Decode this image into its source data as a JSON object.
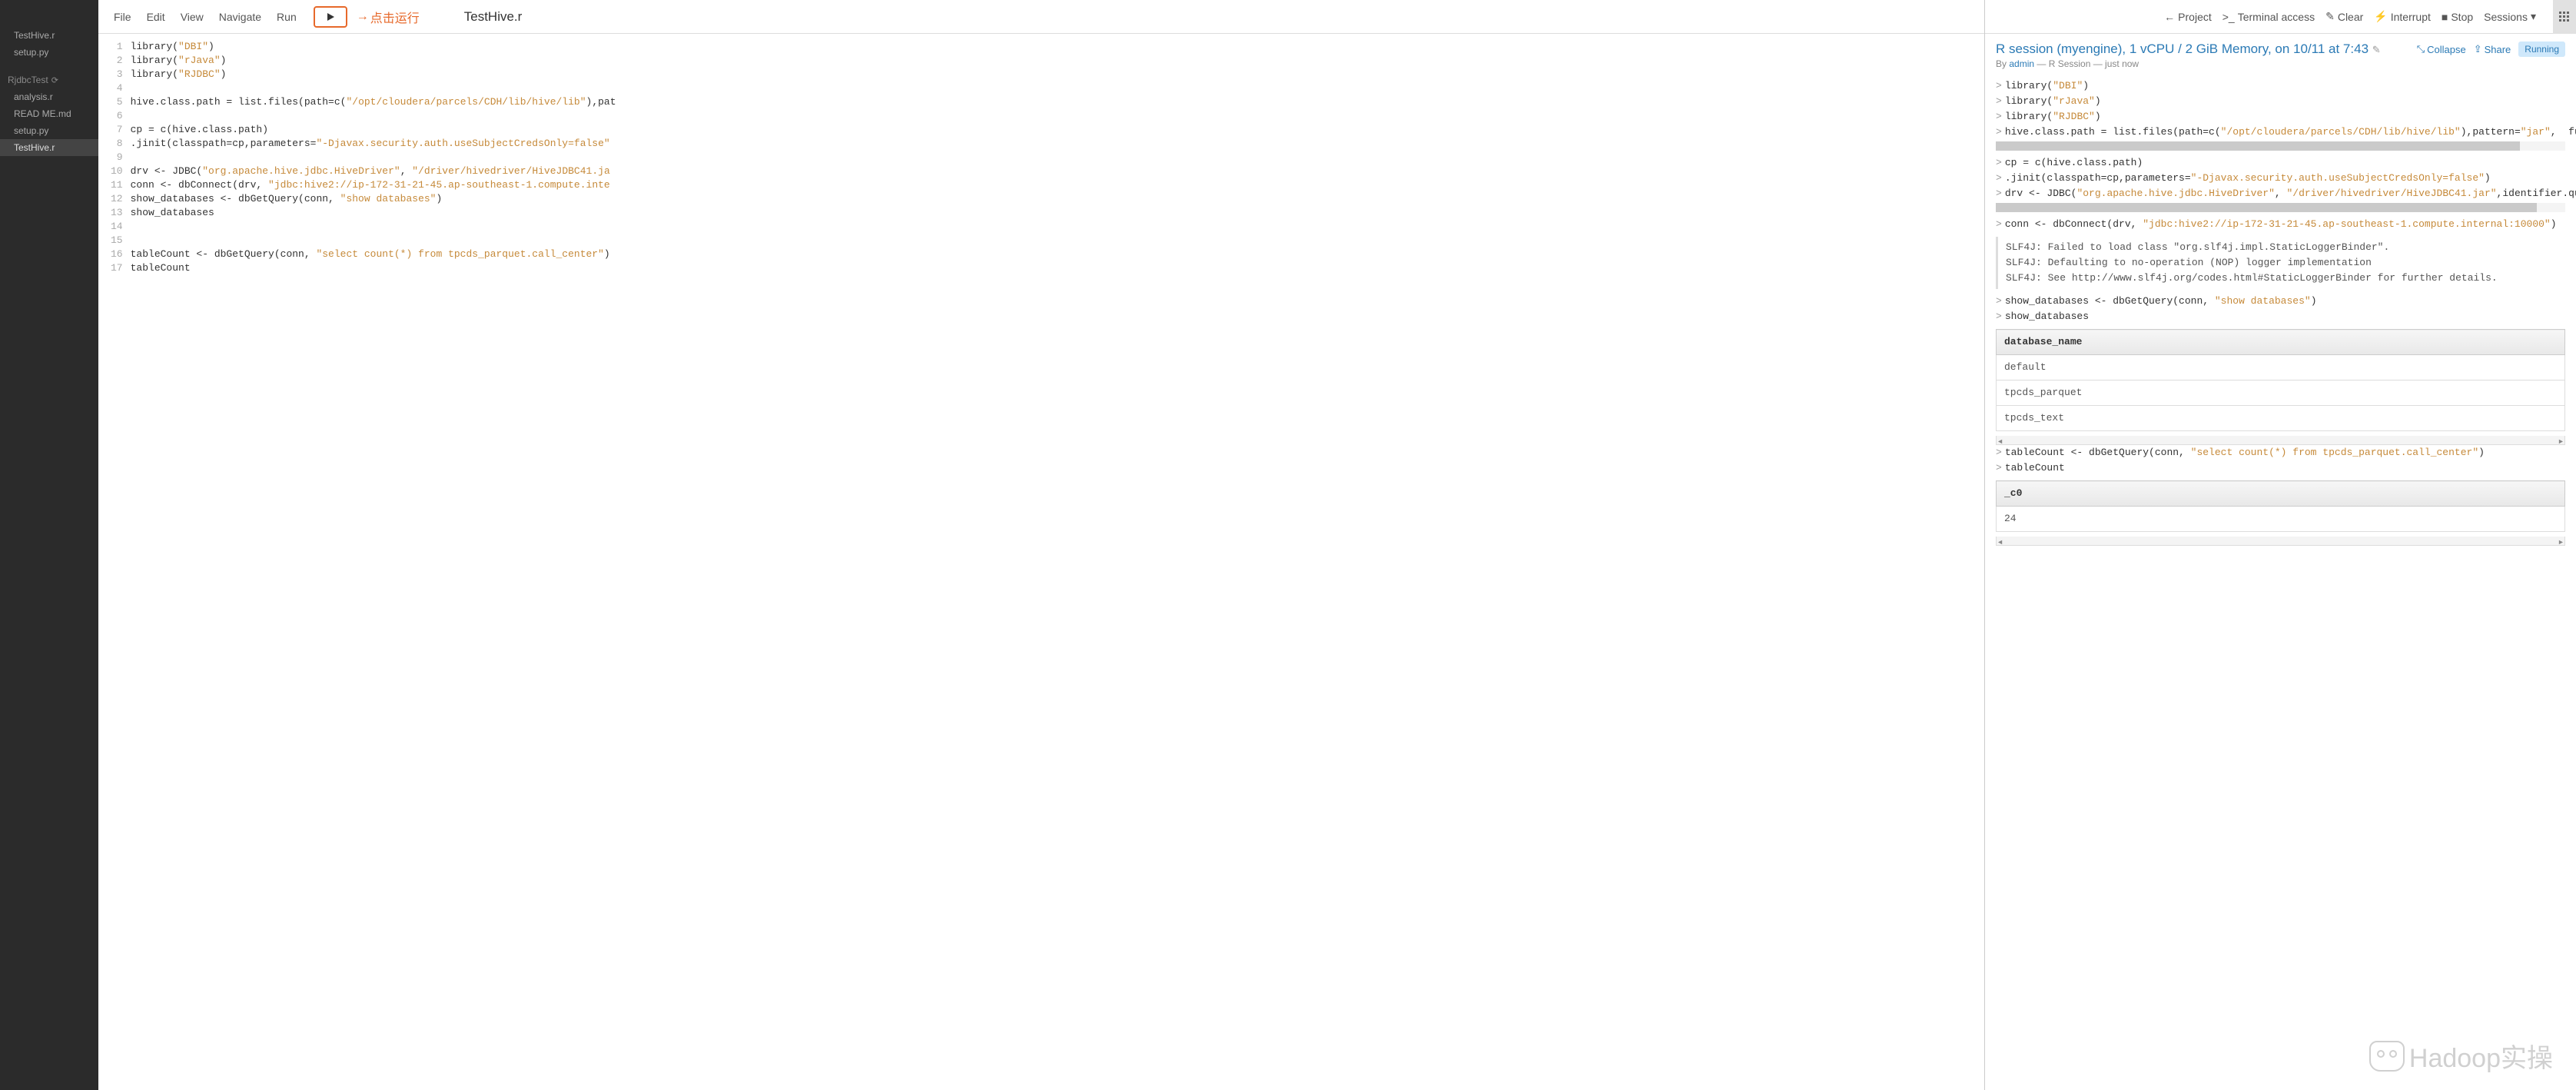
{
  "sidebar": {
    "group1": [
      "TestHive.r",
      "setup.py"
    ],
    "project_header": "RjdbcTest",
    "group2": [
      "analysis.r",
      "READ ME.md",
      "setup.py",
      "TestHive.r"
    ],
    "active": "TestHive.r"
  },
  "menubar": [
    "File",
    "Edit",
    "View",
    "Navigate",
    "Run"
  ],
  "annotation": "点击运行",
  "filename": "TestHive.r",
  "editor": {
    "lines": [
      {
        "n": 1,
        "tokens": [
          {
            "t": "library("
          },
          {
            "t": "\"DBI\"",
            "c": "str"
          },
          {
            "t": ")"
          }
        ]
      },
      {
        "n": 2,
        "tokens": [
          {
            "t": "library("
          },
          {
            "t": "\"rJava\"",
            "c": "str"
          },
          {
            "t": ")"
          }
        ]
      },
      {
        "n": 3,
        "tokens": [
          {
            "t": "library("
          },
          {
            "t": "\"RJDBC\"",
            "c": "str"
          },
          {
            "t": ")"
          }
        ]
      },
      {
        "n": 4,
        "tokens": []
      },
      {
        "n": 5,
        "tokens": [
          {
            "t": "hive.class.path = list.files(path=c("
          },
          {
            "t": "\"/opt/cloudera/parcels/CDH/lib/hive/lib\"",
            "c": "str"
          },
          {
            "t": "),pat"
          }
        ]
      },
      {
        "n": 6,
        "tokens": []
      },
      {
        "n": 7,
        "tokens": [
          {
            "t": "cp = c(hive.class.path)"
          }
        ]
      },
      {
        "n": 8,
        "tokens": [
          {
            "t": ".jinit(classpath=cp,parameters="
          },
          {
            "t": "\"-Djavax.security.auth.useSubjectCredsOnly=false\"",
            "c": "str"
          }
        ]
      },
      {
        "n": 9,
        "tokens": []
      },
      {
        "n": 10,
        "tokens": [
          {
            "t": "drv <- JDBC("
          },
          {
            "t": "\"org.apache.hive.jdbc.HiveDriver\"",
            "c": "str"
          },
          {
            "t": ", "
          },
          {
            "t": "\"/driver/hivedriver/HiveJDBC41.ja",
            "c": "str"
          }
        ]
      },
      {
        "n": 11,
        "tokens": [
          {
            "t": "conn <- dbConnect(drv, "
          },
          {
            "t": "\"jdbc:hive2://ip-172-31-21-45.ap-southeast-1.compute.inte",
            "c": "str"
          }
        ]
      },
      {
        "n": 12,
        "tokens": [
          {
            "t": "show_databases <- dbGetQuery(conn, "
          },
          {
            "t": "\"show databases\"",
            "c": "str"
          },
          {
            "t": ")"
          }
        ]
      },
      {
        "n": 13,
        "tokens": [
          {
            "t": "show_databases"
          }
        ]
      },
      {
        "n": 14,
        "tokens": []
      },
      {
        "n": 15,
        "tokens": []
      },
      {
        "n": 16,
        "tokens": [
          {
            "t": "tableCount <- dbGetQuery(conn, "
          },
          {
            "t": "\"select count(*) from tpcds_parquet.call_center\"",
            "c": "str"
          },
          {
            "t": ")"
          }
        ]
      },
      {
        "n": 17,
        "tokens": [
          {
            "t": "tableCount"
          }
        ]
      }
    ]
  },
  "right_toolbar": {
    "project": "Project",
    "terminal": "Terminal access",
    "clear": "Clear",
    "interrupt": "Interrupt",
    "stop": "Stop",
    "sessions": "Sessions"
  },
  "session": {
    "title": "R session (myengine), 1 vCPU / 2 GiB Memory, on 10/11 at 7:43",
    "by": "By ",
    "user": "admin",
    "meta_rest": " — R Session — just now",
    "collapse": "Collapse",
    "share": "Share",
    "status": "Running"
  },
  "console": [
    {
      "type": "in",
      "tokens": [
        {
          "t": "library("
        },
        {
          "t": "\"DBI\"",
          "c": "str"
        },
        {
          "t": ")"
        }
      ]
    },
    {
      "type": "in",
      "tokens": [
        {
          "t": "library("
        },
        {
          "t": "\"rJava\"",
          "c": "str"
        },
        {
          "t": ")"
        }
      ]
    },
    {
      "type": "in",
      "tokens": [
        {
          "t": "library("
        },
        {
          "t": "\"RJDBC\"",
          "c": "str"
        },
        {
          "t": ")"
        }
      ]
    },
    {
      "type": "in",
      "tokens": [
        {
          "t": "hive.class.path = list.files(path=c("
        },
        {
          "t": "\"/opt/cloudera/parcels/CDH/lib/hive/lib\"",
          "c": "str"
        },
        {
          "t": "),pattern="
        },
        {
          "t": "\"jar\"",
          "c": "str"
        },
        {
          "t": ",  full.na"
        }
      ]
    },
    {
      "type": "hscroll",
      "w": "92%"
    },
    {
      "type": "in",
      "tokens": [
        {
          "t": "cp = c(hive.class.path)"
        }
      ]
    },
    {
      "type": "in",
      "tokens": [
        {
          "t": ".jinit(classpath=cp,parameters="
        },
        {
          "t": "\"-Djavax.security.auth.useSubjectCredsOnly=false\"",
          "c": "str"
        },
        {
          "t": ")"
        }
      ]
    },
    {
      "type": "in",
      "tokens": [
        {
          "t": "drv <- JDBC("
        },
        {
          "t": "\"org.apache.hive.jdbc.HiveDriver\"",
          "c": "str"
        },
        {
          "t": ", "
        },
        {
          "t": "\"/driver/hivedriver/HiveJDBC41.jar\"",
          "c": "str"
        },
        {
          "t": ",identifier.quote="
        }
      ]
    },
    {
      "type": "hscroll",
      "w": "95%"
    },
    {
      "type": "in",
      "tokens": [
        {
          "t": "conn <- dbConnect(drv, "
        },
        {
          "t": "\"jdbc:hive2://ip-172-31-21-45.ap-southeast-1.compute.internal:10000\"",
          "c": "str"
        },
        {
          "t": ")"
        }
      ]
    },
    {
      "type": "out",
      "text": "SLF4J: Failed to load class \"org.slf4j.impl.StaticLoggerBinder\".\nSLF4J: Defaulting to no-operation (NOP) logger implementation\nSLF4J: See http://www.slf4j.org/codes.html#StaticLoggerBinder for further details."
    },
    {
      "type": "in",
      "tokens": [
        {
          "t": "show_databases <- dbGetQuery(conn, "
        },
        {
          "t": "\"show databases\"",
          "c": "str"
        },
        {
          "t": ")"
        }
      ]
    },
    {
      "type": "in",
      "tokens": [
        {
          "t": "show_databases"
        }
      ]
    },
    {
      "type": "table",
      "header": "database_name",
      "rows": [
        "default",
        "tpcds_parquet",
        "tpcds_text"
      ]
    },
    {
      "type": "in",
      "tokens": [
        {
          "t": "tableCount <- dbGetQuery(conn, "
        },
        {
          "t": "\"select count(*) from tpcds_parquet.call_center\"",
          "c": "str"
        },
        {
          "t": ")"
        }
      ]
    },
    {
      "type": "in",
      "tokens": [
        {
          "t": "tableCount"
        }
      ]
    },
    {
      "type": "table",
      "header": "_c0",
      "rows": [
        "24"
      ]
    }
  ],
  "watermark": "Hadoop实操"
}
